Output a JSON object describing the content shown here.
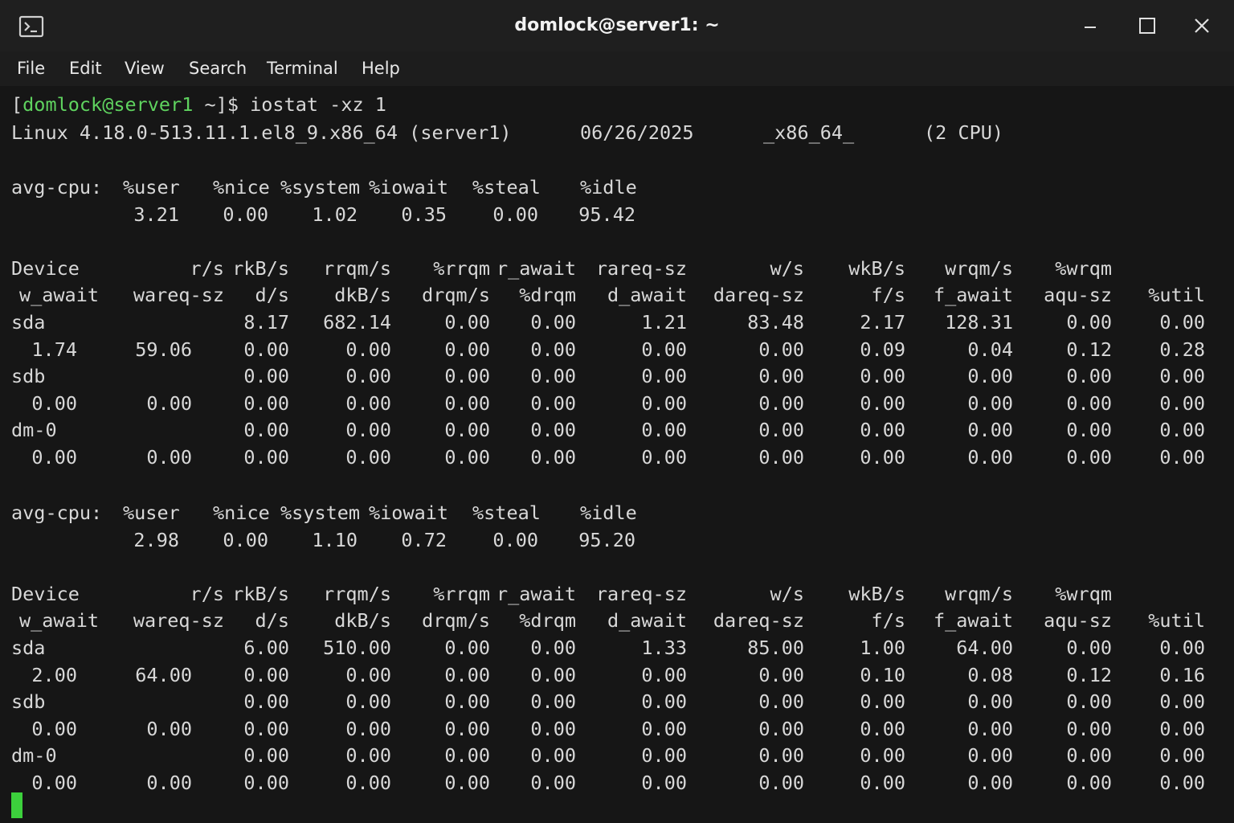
{
  "window": {
    "title": "domlock@server1: ~",
    "icons": {
      "app": "terminal-icon",
      "minimize": "minimize-icon",
      "maximize": "maximize-icon",
      "close": "close-icon"
    }
  },
  "menu": [
    "File",
    "Edit",
    "View",
    "Search",
    "Terminal",
    "Help"
  ],
  "prompt": {
    "open_bracket": "[",
    "user_host": "domlock@server1",
    "cwd": " ~",
    "suffix": "]$ ",
    "command": "iostat -xz 1"
  },
  "header": {
    "kernel": "Linux 4.18.0-513.11.1.el8_9.x86_64 (server1)",
    "date": "06/26/2025",
    "arch": "_x86_64_",
    "cpus": "(2 CPU)"
  },
  "cpu_label": "avg-cpu:",
  "cpu_headers": [
    "%user",
    "%nice",
    "%system",
    "%iowait",
    "%steal",
    "%idle"
  ],
  "device_header_1": [
    "Device",
    "r/s",
    "rkB/s",
    "rrqm/s",
    "%rrqm",
    "r_await",
    "rareq-sz",
    "w/s",
    "wkB/s",
    "wrqm/s",
    "%wrqm"
  ],
  "device_header_2": [
    "w_await",
    "wareq-sz",
    "d/s",
    "dkB/s",
    "drqm/s",
    "%drqm",
    "d_await",
    "dareq-sz",
    "f/s",
    "f_await",
    "aqu-sz",
    "%util"
  ],
  "samples": [
    {
      "cpu_values": [
        "3.21",
        "0.00",
        "1.02",
        "0.35",
        "0.00",
        "95.42"
      ],
      "devices": [
        {
          "name": "sda",
          "line1": [
            "8.17",
            "682.14",
            "0.00",
            "0.00",
            "1.21",
            "83.48",
            "2.17",
            "128.31",
            "0.00",
            "0.00"
          ],
          "line2": [
            "1.74",
            "59.06",
            "0.00",
            "0.00",
            "0.00",
            "0.00",
            "0.00",
            "0.00",
            "0.09",
            "0.04",
            "0.12",
            "0.28"
          ]
        },
        {
          "name": "sdb",
          "line1": [
            "0.00",
            "0.00",
            "0.00",
            "0.00",
            "0.00",
            "0.00",
            "0.00",
            "0.00",
            "0.00",
            "0.00"
          ],
          "line2": [
            "0.00",
            "0.00",
            "0.00",
            "0.00",
            "0.00",
            "0.00",
            "0.00",
            "0.00",
            "0.00",
            "0.00",
            "0.00",
            "0.00"
          ]
        },
        {
          "name": "dm-0",
          "line1": [
            "0.00",
            "0.00",
            "0.00",
            "0.00",
            "0.00",
            "0.00",
            "0.00",
            "0.00",
            "0.00",
            "0.00"
          ],
          "line2": [
            "0.00",
            "0.00",
            "0.00",
            "0.00",
            "0.00",
            "0.00",
            "0.00",
            "0.00",
            "0.00",
            "0.00",
            "0.00",
            "0.00"
          ]
        }
      ]
    },
    {
      "cpu_values": [
        "2.98",
        "0.00",
        "1.10",
        "0.72",
        "0.00",
        "95.20"
      ],
      "devices": [
        {
          "name": "sda",
          "line1": [
            "6.00",
            "510.00",
            "0.00",
            "0.00",
            "1.33",
            "85.00",
            "1.00",
            "64.00",
            "0.00",
            "0.00"
          ],
          "line2": [
            "2.00",
            "64.00",
            "0.00",
            "0.00",
            "0.00",
            "0.00",
            "0.00",
            "0.00",
            "0.10",
            "0.08",
            "0.12",
            "0.16"
          ]
        },
        {
          "name": "sdb",
          "line1": [
            "0.00",
            "0.00",
            "0.00",
            "0.00",
            "0.00",
            "0.00",
            "0.00",
            "0.00",
            "0.00",
            "0.00"
          ],
          "line2": [
            "0.00",
            "0.00",
            "0.00",
            "0.00",
            "0.00",
            "0.00",
            "0.00",
            "0.00",
            "0.00",
            "0.00",
            "0.00",
            "0.00"
          ]
        },
        {
          "name": "dm-0",
          "line1": [
            "0.00",
            "0.00",
            "0.00",
            "0.00",
            "0.00",
            "0.00",
            "0.00",
            "0.00",
            "0.00",
            "0.00"
          ],
          "line2": [
            "0.00",
            "0.00",
            "0.00",
            "0.00",
            "0.00",
            "0.00",
            "0.00",
            "0.00",
            "0.00",
            "0.00",
            "0.00",
            "0.00"
          ]
        }
      ]
    }
  ]
}
